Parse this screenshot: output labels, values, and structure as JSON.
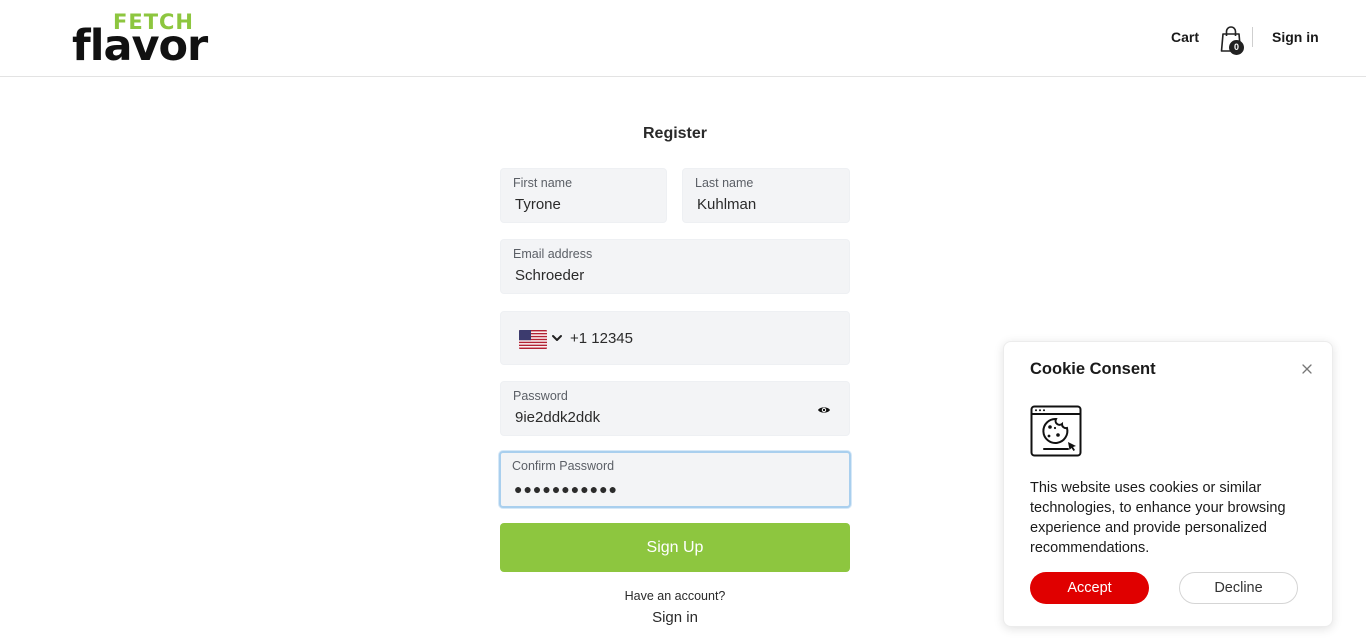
{
  "header": {
    "logo_top": "FETCH",
    "logo_bottom": "flavor",
    "cart_label": "Cart",
    "cart_count": "0",
    "signin_label": "Sign in"
  },
  "form": {
    "title": "Register",
    "first_name": {
      "label": "First name",
      "value": "Tyrone"
    },
    "last_name": {
      "label": "Last name",
      "value": "Kuhlman"
    },
    "email": {
      "label": "Email address",
      "value": "Schroeder"
    },
    "phone": {
      "country": "US",
      "value": "+1 12345"
    },
    "password": {
      "label": "Password",
      "value": "9ie2ddk2ddk"
    },
    "confirm_password": {
      "label": "Confirm Password",
      "value": "●●●●●●●●●●●"
    },
    "submit_label": "Sign Up",
    "have_account": "Have an account?",
    "signin_label": "Sign in"
  },
  "cookie": {
    "title": "Cookie Consent",
    "text": "This website uses cookies or similar technologies, to enhance your browsing experience and provide personalized recommendations.",
    "accept_label": "Accept",
    "decline_label": "Decline"
  },
  "colors": {
    "brand_green": "#8dc63f",
    "accept_red": "#e00000",
    "field_bg": "#f3f4f6",
    "focus_ring": "#a9cfee"
  },
  "icons": [
    "cart-icon",
    "eye-icon",
    "chevron-down-icon",
    "close-icon",
    "cookie-icon",
    "us-flag-icon"
  ]
}
